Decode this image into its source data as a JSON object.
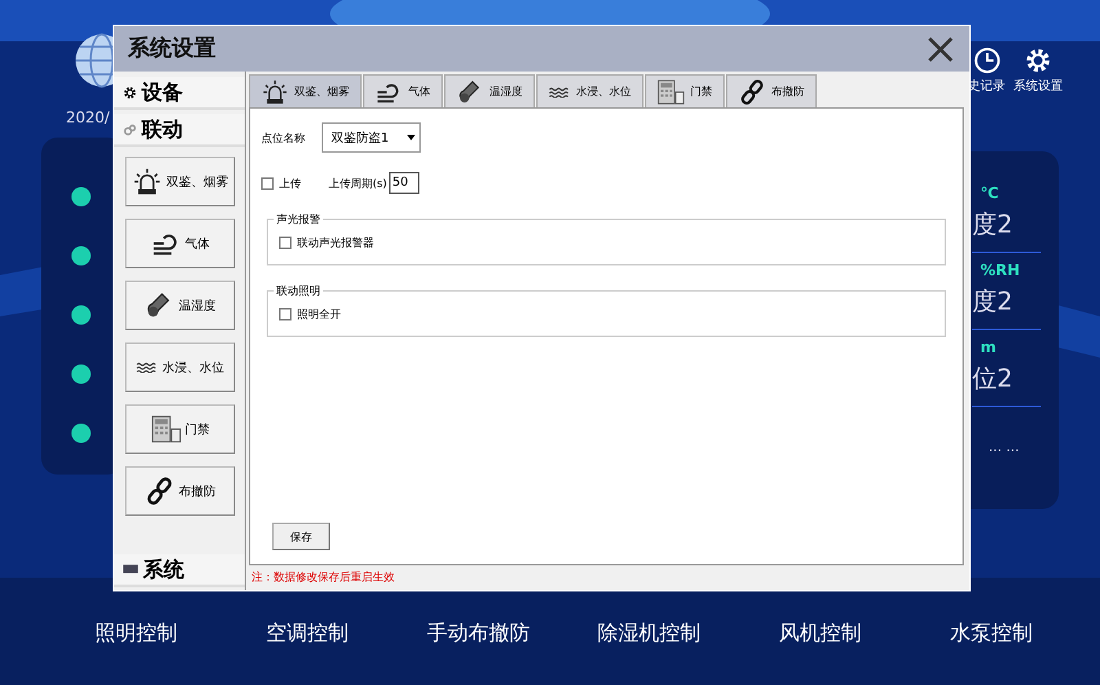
{
  "background": {
    "date": "2020/",
    "header_actions": [
      {
        "label": "史记录",
        "kind": "clock"
      },
      {
        "label": "系统设置",
        "kind": "gear"
      }
    ],
    "readings": [
      {
        "unit": "℃",
        "name": "度2"
      },
      {
        "unit": "%RH",
        "name": "度2"
      },
      {
        "unit": "m",
        "name": "位2"
      }
    ],
    "more": "... ...",
    "controls": [
      {
        "label": "照明控制"
      },
      {
        "label": "空调控制"
      },
      {
        "label": "手动布撤防"
      },
      {
        "label": "除湿机控制"
      },
      {
        "label": "风机控制"
      },
      {
        "label": "水泵控制"
      }
    ]
  },
  "dialog": {
    "title": "系统设置",
    "sections": [
      {
        "label": "设备",
        "kind": "gear"
      },
      {
        "label": "联动",
        "kind": "link"
      }
    ],
    "bottom_section": {
      "label": "系统",
      "kind": "monitor"
    },
    "side_buttons": [
      {
        "label": "双鉴、烟雾",
        "kind": "alarm"
      },
      {
        "label": "气体",
        "kind": "gas"
      },
      {
        "label": "温湿度",
        "kind": "thermo"
      },
      {
        "label": "水浸、水位",
        "kind": "water"
      },
      {
        "label": "门禁",
        "kind": "door"
      },
      {
        "label": "布撤防",
        "kind": "chain"
      }
    ],
    "tabs": [
      {
        "label": "双鉴、烟雾",
        "kind": "alarm",
        "selected": true
      },
      {
        "label": "气体",
        "kind": "gas",
        "selected": false
      },
      {
        "label": "温湿度",
        "kind": "thermo",
        "selected": false
      },
      {
        "label": "水浸、水位",
        "kind": "water",
        "selected": false
      },
      {
        "label": "门禁",
        "kind": "door",
        "selected": false
      },
      {
        "label": "布撤防",
        "kind": "chain",
        "selected": false
      }
    ],
    "point_label": "点位名称",
    "point_value": "双鉴防盗1",
    "upload": {
      "label": "上传",
      "checked": false
    },
    "period_label": "上传周期(s)",
    "period_value": "50",
    "groups": [
      {
        "title": "声光报警",
        "option": {
          "label": "联动声光报警器",
          "checked": false
        }
      },
      {
        "title": "联动照明",
        "option": {
          "label": "照明全开",
          "checked": false
        }
      }
    ],
    "save": "保存",
    "note": "注：数据修改保存后重启生效"
  }
}
